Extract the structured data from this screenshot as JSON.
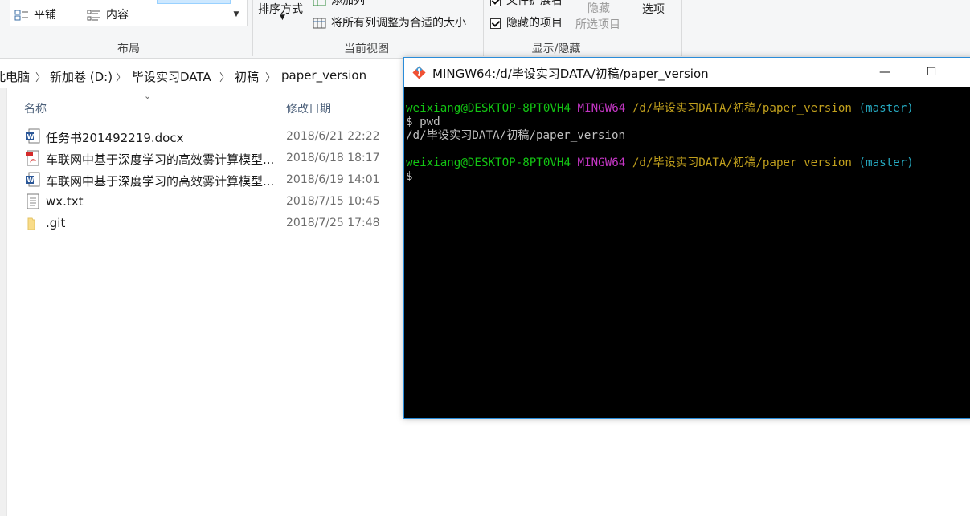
{
  "ribbon": {
    "layout": {
      "tile_label": "平铺",
      "content_label": "内容",
      "group_label": "布局"
    },
    "current_view": {
      "sort_label": "排序方式",
      "add_column_label": "添加列",
      "fit_columns_label": "将所有列调整为合适的大小",
      "group_label": "当前视图"
    },
    "show_hide": {
      "file_ext_label": "文件扩展名",
      "hidden_items_label": "隐藏的项目",
      "hide_label": "隐藏",
      "selected_items_label": "所选项目",
      "group_label": "显示/隐藏"
    },
    "options_label": "选项"
  },
  "address_bar": {
    "crumbs": [
      "此电脑",
      "新加卷 (D:)",
      "毕设实习DATA",
      "初稿",
      "paper_version"
    ]
  },
  "file_list": {
    "columns": {
      "name": "名称",
      "date": "修改日期"
    },
    "rows": [
      {
        "icon": "word-doc-icon",
        "name": "任务书201492219.docx",
        "date": "2018/6/21 22:22"
      },
      {
        "icon": "pdf-icon",
        "name": "车联网中基于深度学习的高效雾计算模型...",
        "date": "2018/6/18 18:17"
      },
      {
        "icon": "word-doc-icon",
        "name": "车联网中基于深度学习的高效雾计算模型...",
        "date": "2018/6/19 14:01"
      },
      {
        "icon": "text-file-icon",
        "name": "wx.txt",
        "date": "2018/7/15 10:45"
      },
      {
        "icon": "folder-icon",
        "name": ".git",
        "date": "2018/7/25 17:48"
      }
    ]
  },
  "terminal": {
    "title": "MINGW64:/d/毕设实习DATA/初稿/paper_version",
    "minimize_label": "—",
    "maximize_label": "☐",
    "lines": {
      "prompt1_user": "weixiang@DESKTOP-8PT0VH4",
      "prompt1_env": "MINGW64",
      "prompt1_path": "/d/毕设实习DATA/初稿/paper_version",
      "prompt1_branch": "(master)",
      "cmd1": "$ pwd",
      "output1": "/d/毕设实习DATA/初稿/paper_version",
      "prompt2_user": "weixiang@DESKTOP-8PT0VH4",
      "prompt2_env": "MINGW64",
      "prompt2_path": "/d/毕设实习DATA/初稿/paper_version",
      "prompt2_branch": "(master)",
      "cursor_prompt": "$"
    },
    "colors": {
      "user": "#13c513",
      "env": "#c436c4",
      "path": "#c1a01d",
      "branch": "#26a9c0"
    }
  }
}
